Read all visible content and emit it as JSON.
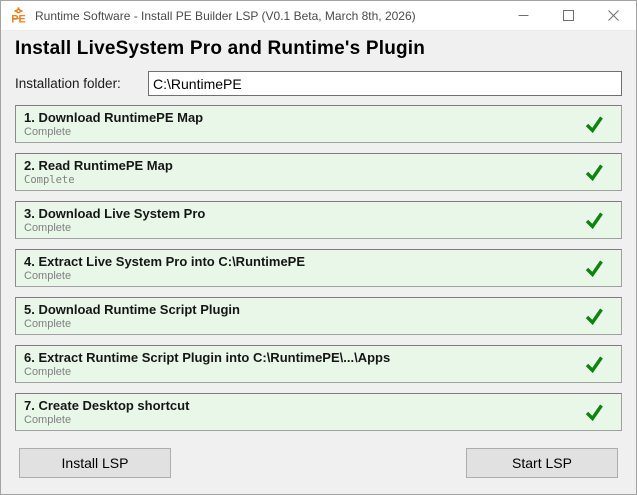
{
  "window": {
    "title": "Runtime Software - Install PE Builder LSP (V0.1 Beta, March 8th, 2026)"
  },
  "heading": "Install LiveSystem Pro and Runtime's Plugin",
  "folder": {
    "label": "Installation folder:",
    "value": "C:\\RuntimePE"
  },
  "steps": [
    {
      "title": "1. Download RuntimePE Map",
      "status": "Complete"
    },
    {
      "title": "2. Read RuntimePE Map",
      "status": "Complete"
    },
    {
      "title": "3. Download Live System Pro",
      "status": "Complete"
    },
    {
      "title": "4. Extract Live System Pro into C:\\RuntimePE",
      "status": "Complete"
    },
    {
      "title": "5. Download Runtime Script Plugin",
      "status": "Complete"
    },
    {
      "title": "6. Extract Runtime Script Plugin into C:\\RuntimePE\\...\\Apps",
      "status": "Complete"
    },
    {
      "title": "7. Create Desktop shortcut",
      "status": "Complete"
    }
  ],
  "buttons": {
    "install": "Install LSP",
    "start": "Start LSP"
  },
  "icons": {
    "app": "pe-builder-logo",
    "step_check": "green-checkmark"
  },
  "colors": {
    "step_bg": "#e9f7e9",
    "check_green": "#0f830f",
    "logo_orange": "#e8821e",
    "titlebar_bg": "#ffffff",
    "window_bg": "#f0f0f0"
  }
}
